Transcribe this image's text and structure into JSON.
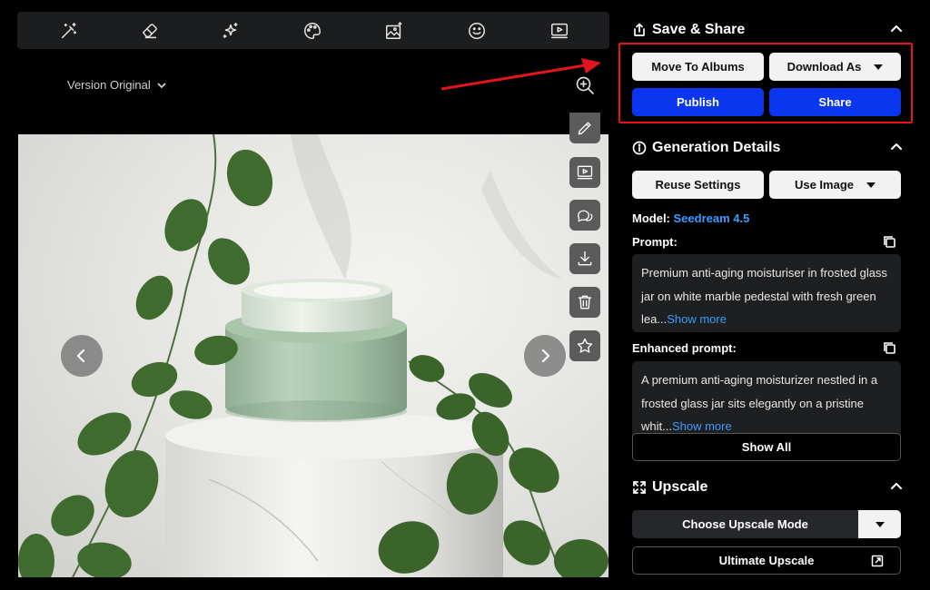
{
  "toolbar": {
    "tools": [
      {
        "icon": "magic-wand-icon"
      },
      {
        "icon": "eraser-icon"
      },
      {
        "icon": "sparkles-icon"
      },
      {
        "icon": "palette-icon"
      },
      {
        "icon": "image-sparkle-icon"
      },
      {
        "icon": "smiley-icon"
      },
      {
        "icon": "video-play-icon"
      }
    ]
  },
  "viewer": {
    "version_label": "Version Original",
    "zoom_icon": "zoom-in-icon",
    "side_tools": [
      "pencil-icon",
      "video-icon",
      "chat-icon",
      "download-icon",
      "trash-icon",
      "star-icon"
    ]
  },
  "save_share": {
    "title": "Save & Share",
    "move_to_albums": "Move To Albums",
    "download_as": "Download As",
    "publish": "Publish",
    "share": "Share"
  },
  "generation": {
    "title": "Generation Details",
    "reuse_settings": "Reuse Settings",
    "use_image": "Use Image",
    "model_label": "Model:",
    "model_value": "Seedream 4.5",
    "prompt_label": "Prompt:",
    "prompt_text": "Premium anti-aging moisturiser in frosted glass jar on white marble pedestal with fresh green lea...",
    "show_more": "Show more",
    "enhanced_label": "Enhanced prompt:",
    "enhanced_text": "A premium anti-aging moisturizer nestled in a frosted glass jar sits elegantly on a pristine whit...",
    "show_all": "Show All"
  },
  "upscale": {
    "title": "Upscale",
    "mode": "Choose Upscale Mode",
    "ultimate": "Ultimate Upscale"
  },
  "colors": {
    "accent_blue": "#0a36f0",
    "link_blue": "#3b9cff",
    "highlight_red": "#e3141b"
  }
}
